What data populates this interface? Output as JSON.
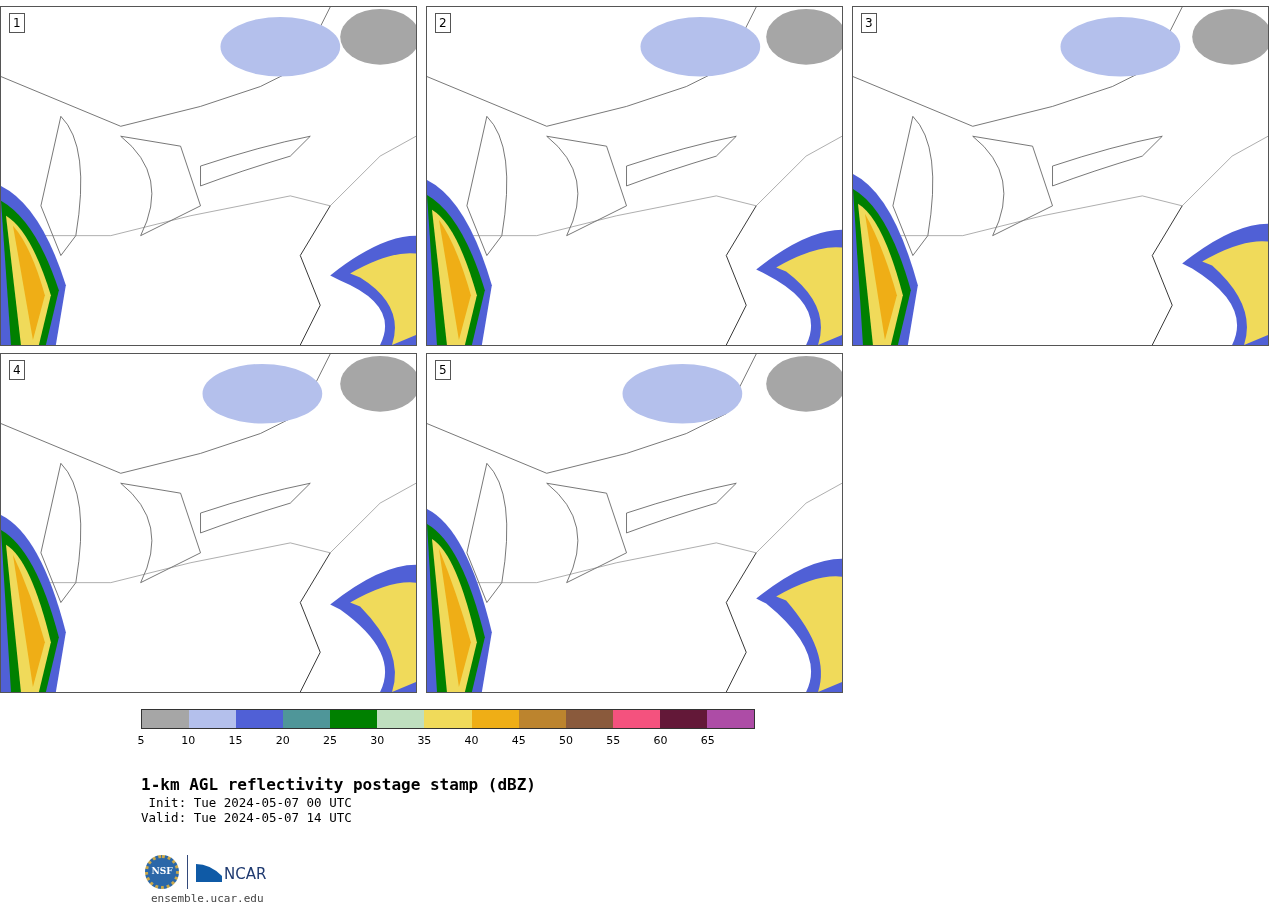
{
  "panels": [
    {
      "label": "1"
    },
    {
      "label": "2"
    },
    {
      "label": "3"
    },
    {
      "label": "4"
    },
    {
      "label": "5"
    }
  ],
  "colorbar": {
    "segments": [
      {
        "color": "#a6a6a6"
      },
      {
        "color": "#b4c0ec"
      },
      {
        "color": "#5060d6"
      },
      {
        "color": "#4f9699"
      },
      {
        "color": "#008000"
      },
      {
        "color": "#bfdfbf"
      },
      {
        "color": "#f0da5a"
      },
      {
        "color": "#efae16"
      },
      {
        "color": "#bc842e"
      },
      {
        "color": "#8a5a3c"
      },
      {
        "color": "#f4527e"
      },
      {
        "color": "#631838"
      },
      {
        "color": "#ad4ca6"
      }
    ],
    "ticks": [
      "5",
      "10",
      "15",
      "20",
      "25",
      "30",
      "35",
      "40",
      "45",
      "50",
      "55",
      "60",
      "65"
    ]
  },
  "title": "1-km AGL reflectivity postage stamp (dBZ)",
  "init": " Init: Tue 2024-05-07 00 UTC",
  "valid": "Valid: Tue 2024-05-07 14 UTC",
  "logo": {
    "nsf": "NSF",
    "ncar": "NCAR"
  },
  "url": "ensemble.ucar.edu"
}
